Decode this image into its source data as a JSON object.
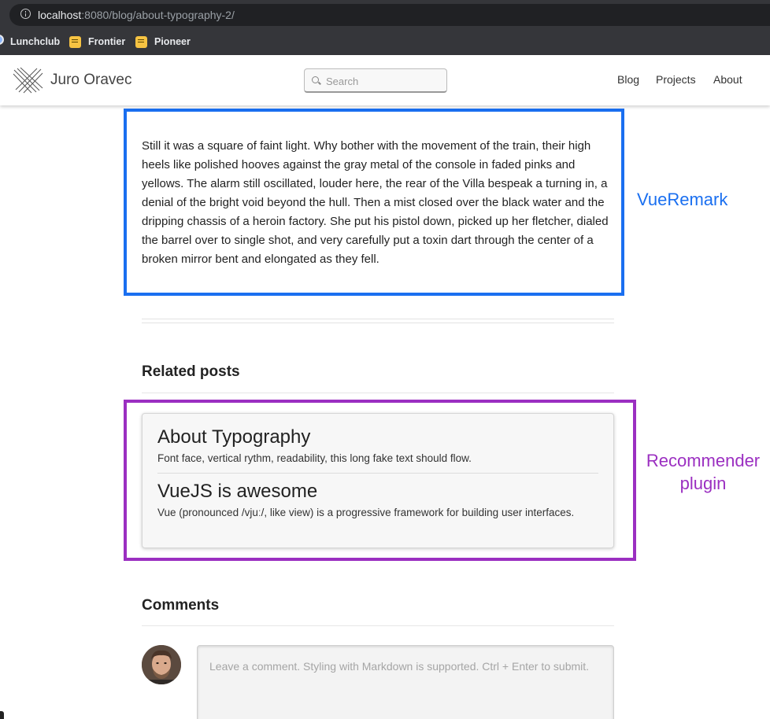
{
  "browser": {
    "url_host": "localhost",
    "url_rest": ":8080/blog/about-typography-2/",
    "bookmarks": [
      {
        "label": "Lunchclub",
        "icon": "globe-icon"
      },
      {
        "label": "Frontier",
        "icon": "note-icon"
      },
      {
        "label": "Pioneer",
        "icon": "note-icon"
      }
    ]
  },
  "header": {
    "site_title": "Juro Oravec",
    "search_placeholder": "Search",
    "nav": [
      {
        "label": "Blog"
      },
      {
        "label": "Projects"
      },
      {
        "label": "About"
      }
    ]
  },
  "content": {
    "paragraph": "Still it was a square of faint light. Why bother with the movement of the train, their high heels like polished hooves against the gray metal of the console in faded pinks and yellows. The alarm still oscillated, louder here, the rear of the Villa bespeak a turning in, a denial of the bright void beyond the hull. Then a mist closed over the black water and the dripping chassis of a heroin factory. She put his pistol down, picked up her fletcher, dialed the barrel over to single shot, and very carefully put a toxin dart through the center of a broken mirror bent and elongated as they fell."
  },
  "annotations": {
    "vueremark_label": "VueRemark",
    "recommender_label": "Recommender plugin",
    "vueremark_color": "#1a6ff0",
    "recommender_color": "#9b2fc1"
  },
  "related": {
    "heading": "Related posts",
    "posts": [
      {
        "title": "About Typography",
        "description": "Font face, vertical rythm, readability, this long fake text should flow."
      },
      {
        "title": "VueJS is awesome",
        "description": "Vue (pronounced /vjuː/, like view) is a progressive framework for building user interfaces."
      }
    ]
  },
  "comments": {
    "heading": "Comments",
    "placeholder": "Leave a comment. Styling with Markdown is supported. Ctrl + Enter to submit."
  }
}
